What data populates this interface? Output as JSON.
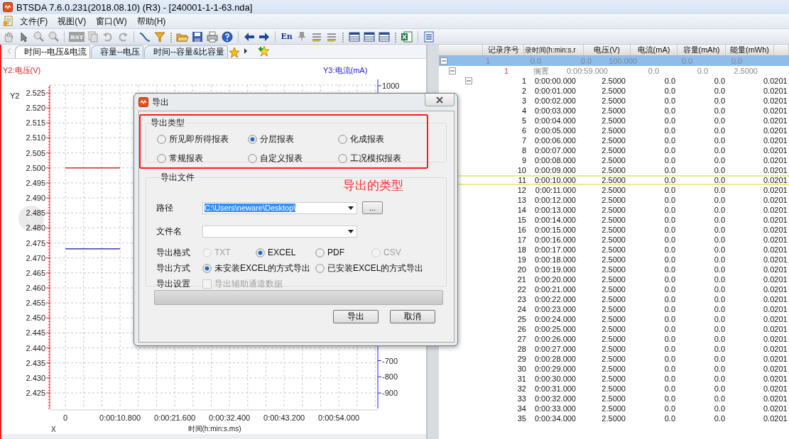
{
  "window": {
    "title": "BTSDA 7.6.0.231(2018.08.10) (R3) - [240001-1-1-63.nda]"
  },
  "menu": [
    "文件(F)",
    "视图(V)",
    "窗口(W)",
    "帮助(H)"
  ],
  "toolbar": {
    "labels": [
      "RST",
      "En"
    ]
  },
  "tabs": [
    {
      "label": "时间--电压&电流",
      "selected": true
    },
    {
      "label": "容量--电压",
      "selected": false
    },
    {
      "label": "时间--容量&比容量",
      "selected": false
    }
  ],
  "chart": {
    "left_title": "Y2:电压(V)",
    "right_title": "Y3:电流(mA)",
    "left_axis_name": "Y2",
    "x_axis_name": "X",
    "right_axis": {
      "ticks": [
        "1000",
        "-700",
        "-800",
        "-900"
      ]
    },
    "chart_data": {
      "type": "line",
      "xlabel": "时间(h:min:s.ms)",
      "categories": [
        "0",
        "0:00:10.800",
        "0:00:21.600",
        "0:00:32.400",
        "0:00:43.200",
        "0:00:54.000"
      ],
      "series": [
        {
          "color": "#d03020",
          "values": [
            2.5,
            2.5,
            null,
            null,
            null,
            null
          ]
        },
        {
          "color": "#1010b0",
          "values": [
            2.473,
            2.473,
            null,
            null,
            null,
            null
          ]
        }
      ],
      "grid": true,
      "ylim": [
        2.4198,
        2.5276
      ],
      "yticks": [
        {
          "value": 2.525,
          "label": "2.525"
        },
        {
          "value": 2.52,
          "label": "2.520"
        },
        {
          "value": 2.515,
          "label": "2.515"
        },
        {
          "value": 2.51,
          "label": "2.510"
        },
        {
          "value": 2.505,
          "label": "2.505"
        },
        {
          "value": 2.5,
          "label": "2.500"
        },
        {
          "value": 2.495,
          "label": "2.495"
        },
        {
          "value": 2.49,
          "label": "2.490"
        },
        {
          "value": 2.485,
          "label": "2.485"
        },
        {
          "value": 2.48,
          "label": "2.480"
        },
        {
          "value": 2.475,
          "label": "2.475"
        },
        {
          "value": 2.47,
          "label": "2.470"
        },
        {
          "value": 2.465,
          "label": "2.465"
        },
        {
          "value": 2.46,
          "label": "2.460"
        },
        {
          "value": 2.455,
          "label": "2.455"
        },
        {
          "value": 2.45,
          "label": "2.450"
        },
        {
          "value": 2.445,
          "label": "2.445"
        },
        {
          "value": 2.44,
          "label": "2.440"
        },
        {
          "value": 2.435,
          "label": "2.435"
        },
        {
          "value": 2.43,
          "label": "2.430"
        },
        {
          "value": 2.425,
          "label": "2.425"
        }
      ]
    }
  },
  "table": {
    "columns": [
      "记录序号",
      "录时间(h:min:s.r",
      "电压(V)",
      "电流(mA)",
      "容量(mAh)",
      "能量(mWh)"
    ],
    "rows": [
      {
        "cells": [
          "1",
          "0.0",
          "0.0",
          "100.000",
          "0.0",
          "0.0"
        ],
        "selected": true,
        "expanded": true,
        "children": [
          {
            "cells": [
              "1",
              "搁置",
              "0:00:59.000",
              "0.0",
              "0.0",
              "2.5000"
            ],
            "selected": false,
            "expanded": true,
            "records_expanded": true,
            "children": [
              {
                "cells": [
                  "1",
                  "0:00:00.000",
                  "2.5000",
                  "0.0",
                  "0.0",
                  "0.0201"
                ],
                "selected": false
              },
              {
                "cells": [
                  "2",
                  "0:00:01.000",
                  "2.5000",
                  "0.0",
                  "0.0",
                  "0.0201"
                ],
                "selected": false
              },
              {
                "cells": [
                  "3",
                  "0:00:02.000",
                  "2.5000",
                  "0.0",
                  "0.0",
                  "0.0201"
                ],
                "selected": false
              },
              {
                "cells": [
                  "4",
                  "0:00:03.000",
                  "2.5000",
                  "0.0",
                  "0.0",
                  "0.0201"
                ],
                "selected": false
              },
              {
                "cells": [
                  "5",
                  "0:00:04.000",
                  "2.5000",
                  "0.0",
                  "0.0",
                  "0.0201"
                ],
                "selected": false
              },
              {
                "cells": [
                  "6",
                  "0:00:05.000",
                  "2.5000",
                  "0.0",
                  "0.0",
                  "0.0201"
                ],
                "selected": false
              },
              {
                "cells": [
                  "7",
                  "0:00:06.000",
                  "2.5000",
                  "0.0",
                  "0.0",
                  "0.0201"
                ],
                "selected": false
              },
              {
                "cells": [
                  "8",
                  "0:00:07.000",
                  "2.5000",
                  "0.0",
                  "0.0",
                  "0.0201"
                ],
                "selected": false
              },
              {
                "cells": [
                  "9",
                  "0:00:08.000",
                  "2.5000",
                  "0.0",
                  "0.0",
                  "0.0201"
                ],
                "selected": false
              },
              {
                "cells": [
                  "10",
                  "0:00:09.000",
                  "2.5000",
                  "0.0",
                  "0.0",
                  "0.0201"
                ],
                "selected": false
              },
              {
                "cells": [
                  "11",
                  "0:00:10.000",
                  "2.5000",
                  "0.0",
                  "0.0",
                  "0.0201"
                ],
                "selected": true
              },
              {
                "cells": [
                  "12",
                  "0:00:11.000",
                  "2.5000",
                  "0.0",
                  "0.0",
                  "0.0201"
                ],
                "selected": false
              },
              {
                "cells": [
                  "13",
                  "0:00:12.000",
                  "2.5000",
                  "0.0",
                  "0.0",
                  "0.0201"
                ],
                "selected": false
              },
              {
                "cells": [
                  "14",
                  "0:00:13.000",
                  "2.5000",
                  "0.0",
                  "0.0",
                  "0.0201"
                ],
                "selected": false
              },
              {
                "cells": [
                  "15",
                  "0:00:14.000",
                  "2.5000",
                  "0.0",
                  "0.0",
                  "0.0201"
                ],
                "selected": false
              },
              {
                "cells": [
                  "16",
                  "0:00:15.000",
                  "2.5000",
                  "0.0",
                  "0.0",
                  "0.0201"
                ],
                "selected": false
              },
              {
                "cells": [
                  "17",
                  "0:00:16.000",
                  "2.5000",
                  "0.0",
                  "0.0",
                  "0.0201"
                ],
                "selected": false
              },
              {
                "cells": [
                  "18",
                  "0:00:17.000",
                  "2.5000",
                  "0.0",
                  "0.0",
                  "0.0201"
                ],
                "selected": false
              },
              {
                "cells": [
                  "19",
                  "0:00:18.000",
                  "2.5000",
                  "0.0",
                  "0.0",
                  "0.0201"
                ],
                "selected": false
              },
              {
                "cells": [
                  "20",
                  "0:00:19.000",
                  "2.5000",
                  "0.0",
                  "0.0",
                  "0.0201"
                ],
                "selected": false
              },
              {
                "cells": [
                  "21",
                  "0:00:20.000",
                  "2.5000",
                  "0.0",
                  "0.0",
                  "0.0201"
                ],
                "selected": false
              },
              {
                "cells": [
                  "22",
                  "0:00:21.000",
                  "2.5000",
                  "0.0",
                  "0.0",
                  "0.0201"
                ],
                "selected": false
              },
              {
                "cells": [
                  "23",
                  "0:00:22.000",
                  "2.5000",
                  "0.0",
                  "0.0",
                  "0.0201"
                ],
                "selected": false
              },
              {
                "cells": [
                  "24",
                  "0:00:23.000",
                  "2.5000",
                  "0.0",
                  "0.0",
                  "0.0201"
                ],
                "selected": false
              },
              {
                "cells": [
                  "25",
                  "0:00:24.000",
                  "2.5000",
                  "0.0",
                  "0.0",
                  "0.0201"
                ],
                "selected": false
              },
              {
                "cells": [
                  "26",
                  "0:00:25.000",
                  "2.5000",
                  "0.0",
                  "0.0",
                  "0.0201"
                ],
                "selected": false
              },
              {
                "cells": [
                  "27",
                  "0:00:26.000",
                  "2.5000",
                  "0.0",
                  "0.0",
                  "0.0201"
                ],
                "selected": false
              },
              {
                "cells": [
                  "28",
                  "0:00:27.000",
                  "2.5000",
                  "0.0",
                  "0.0",
                  "0.0201"
                ],
                "selected": false
              },
              {
                "cells": [
                  "29",
                  "0:00:28.000",
                  "2.5000",
                  "0.0",
                  "0.0",
                  "0.0201"
                ],
                "selected": false
              },
              {
                "cells": [
                  "30",
                  "0:00:29.000",
                  "2.5000",
                  "0.0",
                  "0.0",
                  "0.0201"
                ],
                "selected": false
              },
              {
                "cells": [
                  "31",
                  "0:00:30.000",
                  "2.5000",
                  "0.0",
                  "0.0",
                  "0.0201"
                ],
                "selected": false
              },
              {
                "cells": [
                  "32",
                  "0:00:31.000",
                  "2.5000",
                  "0.0",
                  "0.0",
                  "0.0201"
                ],
                "selected": false
              },
              {
                "cells": [
                  "33",
                  "0:00:32.000",
                  "2.5000",
                  "0.0",
                  "0.0",
                  "0.0201"
                ],
                "selected": false
              },
              {
                "cells": [
                  "34",
                  "0:00:33.000",
                  "2.5000",
                  "0.0",
                  "0.0",
                  "0.0201"
                ],
                "selected": false
              },
              {
                "cells": [
                  "35",
                  "0:00:34.000",
                  "2.5000",
                  "0.0",
                  "0.0",
                  "0.0201"
                ],
                "selected": false
              }
            ]
          }
        ]
      }
    ]
  },
  "dialog": {
    "title": "导出",
    "type_group": {
      "title": "导出类型",
      "options": [
        {
          "label": "所见即所得报表",
          "selected": false,
          "disabled": false
        },
        {
          "label": "分层报表",
          "selected": true,
          "disabled": false
        },
        {
          "label": "化成报表",
          "selected": false,
          "disabled": false
        },
        {
          "label": "常规报表",
          "selected": false,
          "disabled": false
        },
        {
          "label": "自定义报表",
          "selected": false,
          "disabled": false
        },
        {
          "label": "工况模拟报表",
          "selected": false,
          "disabled": false
        }
      ]
    },
    "annotation": "导出的类型",
    "file_group": {
      "title": "导出文件",
      "path": {
        "label": "路径",
        "value": "C:\\Users\\neware\\Desktop\\",
        "selected": true
      },
      "browse": "...",
      "filename": {
        "label": "文件名"
      },
      "format": {
        "label": "导出格式",
        "options": [
          {
            "label": "TXT",
            "selected": false,
            "disabled": true
          },
          {
            "label": "EXCEL",
            "selected": true,
            "disabled": false
          },
          {
            "label": "PDF",
            "selected": false,
            "disabled": false
          },
          {
            "label": "CSV",
            "selected": false,
            "disabled": true
          }
        ]
      },
      "mode": {
        "label": "导出方式",
        "options": [
          {
            "label": "未安装EXCEL的方式导出",
            "selected": true,
            "disabled": false
          },
          {
            "label": "已安装EXCEL的方式导出",
            "selected": false,
            "disabled": false
          }
        ]
      },
      "settings": {
        "label": "导出设置",
        "checkbox": {
          "label": "导出辅助通道数据",
          "checked": false,
          "disabled": true
        }
      }
    },
    "progress": {
      "level": 0
    },
    "buttons": [
      "导出",
      "取消"
    ]
  }
}
